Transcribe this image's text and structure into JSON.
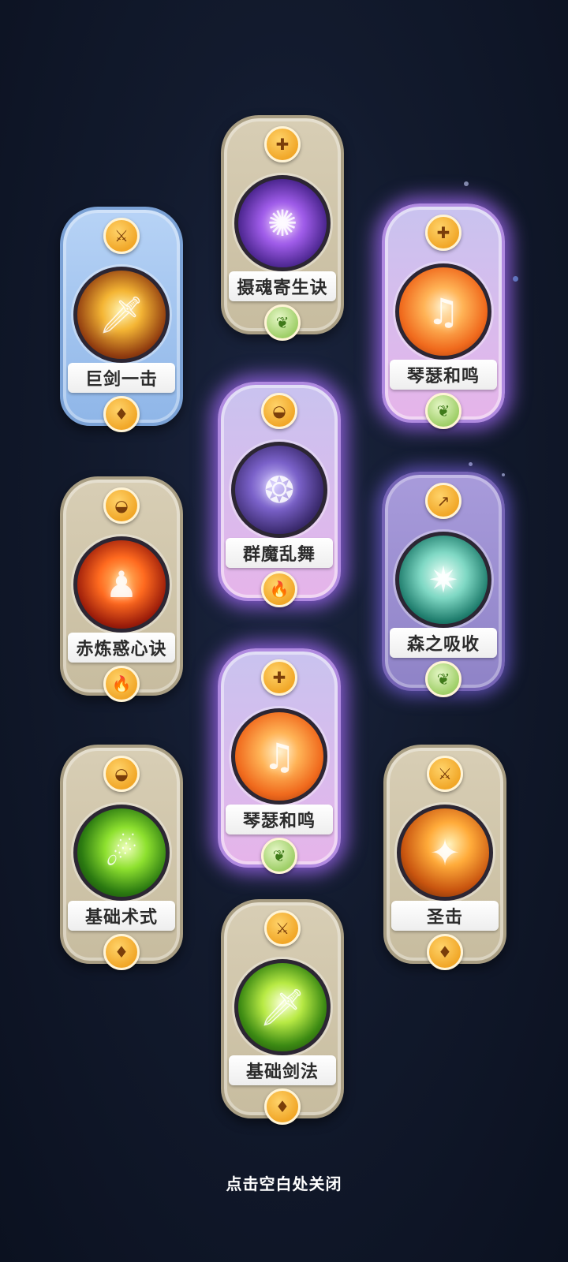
{
  "cards": [
    {
      "name": "巨剑一击",
      "style": "blue",
      "top_icon": "sword-icon",
      "orb": "sword-gold",
      "bottom_icon": "flame-crest-icon"
    },
    {
      "name": "摄魂寄生诀",
      "style": "gray",
      "top_icon": "heart-plus-icon",
      "orb": "soul-purple",
      "bottom_icon": "leaf-icon"
    },
    {
      "name": "琴瑟和鸣",
      "style": "purple",
      "top_icon": "heart-plus-icon",
      "orb": "music-orange",
      "bottom_icon": "leaf-icon"
    },
    {
      "name": "群魔乱舞",
      "style": "purple",
      "top_icon": "mortar-icon",
      "orb": "dark-purple",
      "bottom_icon": "fire-icon"
    },
    {
      "name": "赤炼惑心诀",
      "style": "gray",
      "top_icon": "mortar-icon",
      "orb": "fire-red",
      "bottom_icon": "fire-icon"
    },
    {
      "name": "森之吸收",
      "style": "violet",
      "top_icon": "spear-icon",
      "orb": "wind-teal",
      "bottom_icon": "leaf-icon"
    },
    {
      "name": "琴瑟和鸣",
      "style": "purple",
      "top_icon": "heart-plus-icon",
      "orb": "music-orange",
      "bottom_icon": "leaf-icon"
    },
    {
      "name": "基础术式",
      "style": "gray",
      "top_icon": "mortar-icon",
      "orb": "green-streak",
      "bottom_icon": "flame-crest-icon"
    },
    {
      "name": "圣击",
      "style": "gray",
      "top_icon": "sword-icon",
      "orb": "holy-orange",
      "bottom_icon": "flame-crest-icon"
    },
    {
      "name": "基础剑法",
      "style": "gray",
      "top_icon": "sword-icon",
      "orb": "green-sword",
      "bottom_icon": "flame-crest-icon"
    }
  ],
  "close_hint": "点击空白处关闭"
}
